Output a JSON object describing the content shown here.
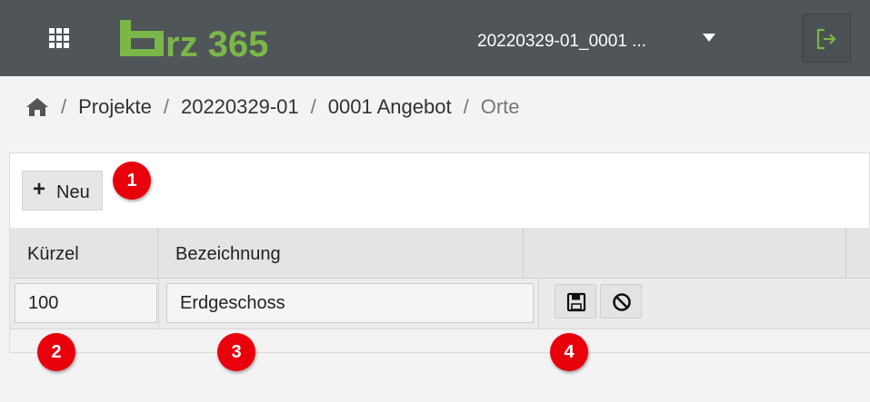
{
  "header": {
    "logo_text": "rz 365",
    "project_selector": {
      "value": "20220329-01_0001 ..."
    },
    "icons": {
      "apps": "grid-icon",
      "logout": "sign-out-icon",
      "dropdown": "caret-down-icon"
    },
    "colors": {
      "bar": "#4f5559",
      "logo_green": "#7ab648"
    }
  },
  "breadcrumb": {
    "home_icon": "home-icon",
    "items": [
      "Projekte",
      "20220329-01",
      "0001 Angebot"
    ],
    "current": "Orte",
    "separator": "/"
  },
  "toolbar": {
    "new_label": "Neu",
    "new_icon": "plus-icon"
  },
  "table": {
    "columns": [
      "Kürzel",
      "Bezeichnung",
      ""
    ],
    "editing_row": {
      "kuerzel": "100",
      "bezeichnung": "Erdgeschoss"
    },
    "row_actions": [
      "save-icon",
      "cancel-icon"
    ]
  },
  "callouts": [
    "1",
    "2",
    "3",
    "4"
  ],
  "colors": {
    "callout": "#e8000b"
  }
}
